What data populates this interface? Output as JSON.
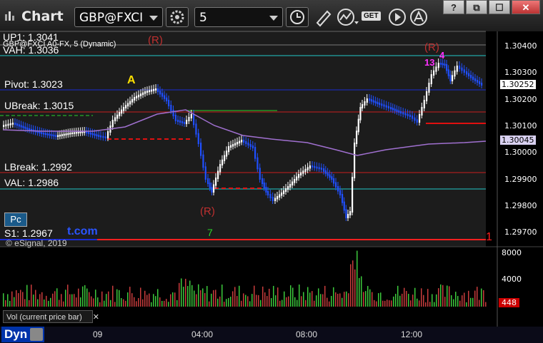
{
  "toolbar": {
    "app_title": "Chart",
    "symbol": "GBP@FXCI",
    "interval": "5",
    "get_label": "GET",
    "window_buttons": [
      "?",
      "⧉",
      "☐",
      "✕"
    ]
  },
  "chart": {
    "series_label": "GBP@FXCI A0-FX, 5 (Dynamic)",
    "copyright": "© eSignal, 2019",
    "price_axis": [
      "1.30400",
      "1.30300",
      "1.30200",
      "1.30100",
      "1.30000",
      "1.29900",
      "1.29800",
      "1.29700"
    ],
    "current_price": "1.30252",
    "ma_price": "1.30045",
    "volume_axis": [
      "8000",
      "4000"
    ],
    "current_volume": "448",
    "volume_label": "Vol (current price bar)",
    "time_labels": [
      "09",
      "04:00",
      "08:00",
      "12:00"
    ],
    "dyn_label": "Dyn",
    "pc_label": "Pc",
    "watermark": "t.com",
    "levels": {
      "up1": "UP1: 1.3041",
      "vah": "VAH: 1.3036",
      "pivot": "Pivot: 1.3023",
      "ubreak": "UBreak: 1.3015",
      "lbreak": "LBreak: 1.2992",
      "val": "VAL: 1.2986",
      "s1": "S1: 1.2967"
    },
    "markers": {
      "r_label": "(R)",
      "a_label": "A",
      "seven": "7",
      "one": "1",
      "thirteen": "13",
      "four": "4"
    },
    "colors": {
      "background": "#1c1c1c",
      "up_candle": "#ffffff",
      "down_candle": "#1f4fff",
      "pivot_line": "#1a2bd0",
      "break_line": "#c81e1e",
      "value_line": "#22c8c8",
      "ma_line": "#a070d0",
      "volume_up": "#3cc83c",
      "volume_down": "#c83c3c"
    }
  }
}
